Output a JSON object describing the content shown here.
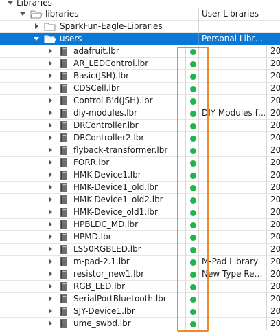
{
  "colors": {
    "selection": "#0a78d6",
    "status_dot": "#1fb548",
    "highlight_box": "#f08a24"
  },
  "tree": {
    "root": {
      "label": "Libraries"
    },
    "libraries": {
      "label": "libraries",
      "description": "User Libraries"
    },
    "sparkfun": {
      "label": "SparkFun-Eagle-Libraries"
    },
    "users": {
      "label": "users",
      "description": "Personal Libr…"
    },
    "files": [
      {
        "label": "adafruit.lbr",
        "description": "",
        "col2": "20"
      },
      {
        "label": "AR_LEDControl.lbr",
        "description": "",
        "col2": "20"
      },
      {
        "label": "Basic(JSH).lbr",
        "description": "",
        "col2": "20"
      },
      {
        "label": "CDSCell.lbr",
        "description": "",
        "col2": "20"
      },
      {
        "label": "Control B'd(JSH).lbr",
        "description": "",
        "col2": "20"
      },
      {
        "label": "diy-modules.lbr",
        "description": "DIY Modules f…",
        "col2": "20"
      },
      {
        "label": "DRController.lbr",
        "description": "",
        "col2": "20"
      },
      {
        "label": "DRController2.lbr",
        "description": "",
        "col2": "20"
      },
      {
        "label": "flyback-transformer.lbr",
        "description": "",
        "col2": "20"
      },
      {
        "label": "FORR.lbr",
        "description": "",
        "col2": "20"
      },
      {
        "label": "HMK-Device1.lbr",
        "description": "",
        "col2": "20"
      },
      {
        "label": "HMK-Device1_old.lbr",
        "description": "",
        "col2": "20"
      },
      {
        "label": "HMK-Device1_old2.lbr",
        "description": "",
        "col2": "20"
      },
      {
        "label": "HMK-Device_old1.lbr",
        "description": "",
        "col2": "20"
      },
      {
        "label": "HPBLDC_MD.lbr",
        "description": "",
        "col2": "20"
      },
      {
        "label": "HPMD.lbr",
        "description": "",
        "col2": "20"
      },
      {
        "label": "LS50RGBLED.lbr",
        "description": "",
        "col2": "20"
      },
      {
        "label": "m-pad-2.1.lbr",
        "description": "M-Pad Library",
        "col2": "20"
      },
      {
        "label": "resistor_new1.lbr",
        "description": "New Type Re…",
        "col2": "20"
      },
      {
        "label": "RGB_LED.lbr",
        "description": "",
        "col2": "20"
      },
      {
        "label": "SerialPortBluetooth.lbr",
        "description": "",
        "col2": "20"
      },
      {
        "label": "SJY-Device1.lbr",
        "description": "",
        "col2": "20"
      },
      {
        "label": "ume_swbd.lbr",
        "description": "",
        "col2": "20"
      }
    ]
  }
}
